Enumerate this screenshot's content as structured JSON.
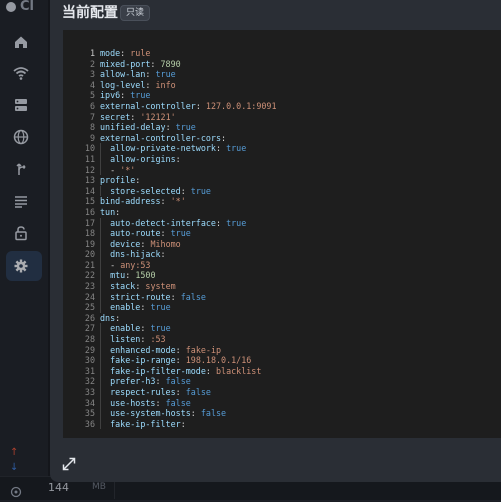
{
  "app": {
    "logo_text": "Cl",
    "traffic_up": "↑",
    "traffic_down": "↓",
    "memory_value": "144",
    "memory_unit": "MB"
  },
  "modal": {
    "title": "当前配置",
    "badge": "只读"
  },
  "editor": {
    "lines": [
      {
        "num": "1",
        "indent": 0,
        "key": "mode",
        "value": "rule",
        "vtype": "s"
      },
      {
        "num": "2",
        "indent": 0,
        "key": "mixed-port",
        "value": "7890",
        "vtype": "n"
      },
      {
        "num": "3",
        "indent": 0,
        "key": "allow-lan",
        "value": "true",
        "vtype": "b"
      },
      {
        "num": "4",
        "indent": 0,
        "key": "log-level",
        "value": "info",
        "vtype": "s"
      },
      {
        "num": "5",
        "indent": 0,
        "key": "ipv6",
        "value": "true",
        "vtype": "b"
      },
      {
        "num": "6",
        "indent": 0,
        "key": "external-controller",
        "value": "127.0.0.1:9091",
        "vtype": "s"
      },
      {
        "num": "7",
        "indent": 0,
        "key": "secret",
        "value": "'12121'",
        "vtype": "s"
      },
      {
        "num": "8",
        "indent": 0,
        "key": "unified-delay",
        "value": "true",
        "vtype": "b"
      },
      {
        "num": "9",
        "indent": 0,
        "key": "external-controller-cors",
        "value": "",
        "vtype": "s"
      },
      {
        "num": "10",
        "indent": 1,
        "key": "allow-private-network",
        "value": "true",
        "vtype": "b"
      },
      {
        "num": "11",
        "indent": 1,
        "key": "allow-origins",
        "value": "",
        "vtype": "s"
      },
      {
        "num": "12",
        "indent": 1,
        "dash": true,
        "key": "",
        "value": "'*'",
        "vtype": "s"
      },
      {
        "num": "13",
        "indent": 0,
        "key": "profile",
        "value": "",
        "vtype": "s"
      },
      {
        "num": "14",
        "indent": 1,
        "key": "store-selected",
        "value": "true",
        "vtype": "b"
      },
      {
        "num": "15",
        "indent": 0,
        "key": "bind-address",
        "value": "'*'",
        "vtype": "s"
      },
      {
        "num": "16",
        "indent": 0,
        "key": "tun",
        "value": "",
        "vtype": "s"
      },
      {
        "num": "17",
        "indent": 1,
        "key": "auto-detect-interface",
        "value": "true",
        "vtype": "b"
      },
      {
        "num": "18",
        "indent": 1,
        "key": "auto-route",
        "value": "true",
        "vtype": "b"
      },
      {
        "num": "19",
        "indent": 1,
        "key": "device",
        "value": "Mihomo",
        "vtype": "s"
      },
      {
        "num": "20",
        "indent": 1,
        "key": "dns-hijack",
        "value": "",
        "vtype": "s"
      },
      {
        "num": "21",
        "indent": 1,
        "dash": true,
        "key": "",
        "value": "any:53",
        "vtype": "s"
      },
      {
        "num": "22",
        "indent": 1,
        "key": "mtu",
        "value": "1500",
        "vtype": "n"
      },
      {
        "num": "23",
        "indent": 1,
        "key": "stack",
        "value": "system",
        "vtype": "s"
      },
      {
        "num": "24",
        "indent": 1,
        "key": "strict-route",
        "value": "false",
        "vtype": "b"
      },
      {
        "num": "25",
        "indent": 1,
        "key": "enable",
        "value": "true",
        "vtype": "b"
      },
      {
        "num": "26",
        "indent": 0,
        "key": "dns",
        "value": "",
        "vtype": "s"
      },
      {
        "num": "27",
        "indent": 1,
        "key": "enable",
        "value": "true",
        "vtype": "b"
      },
      {
        "num": "28",
        "indent": 1,
        "key": "listen",
        "value": ":53",
        "vtype": "s"
      },
      {
        "num": "29",
        "indent": 1,
        "key": "enhanced-mode",
        "value": "fake-ip",
        "vtype": "s"
      },
      {
        "num": "30",
        "indent": 1,
        "key": "fake-ip-range",
        "value": "198.18.0.1/16",
        "vtype": "s"
      },
      {
        "num": "31",
        "indent": 1,
        "key": "fake-ip-filter-mode",
        "value": "blacklist",
        "vtype": "s"
      },
      {
        "num": "32",
        "indent": 1,
        "key": "prefer-h3",
        "value": "false",
        "vtype": "b"
      },
      {
        "num": "33",
        "indent": 1,
        "key": "respect-rules",
        "value": "false",
        "vtype": "b"
      },
      {
        "num": "34",
        "indent": 1,
        "key": "use-hosts",
        "value": "false",
        "vtype": "b"
      },
      {
        "num": "35",
        "indent": 1,
        "key": "use-system-hosts",
        "value": "false",
        "vtype": "b"
      },
      {
        "num": "36",
        "indent": 1,
        "key": "fake-ip-filter",
        "value": "",
        "vtype": "s"
      }
    ]
  },
  "icons": {
    "sidebar": [
      "home-icon",
      "wifi-icon",
      "server-icon",
      "globe-icon",
      "routing-icon",
      "logs-icon",
      "lock-icon",
      "gear-icon"
    ],
    "expand": "expand-icon",
    "memory": "memory-icon"
  },
  "colors": {
    "key": "#9cdcfe",
    "string": "#ce9178",
    "number": "#b5cea8",
    "boolean": "#569cd6",
    "active_nav": "#2d3e57"
  }
}
